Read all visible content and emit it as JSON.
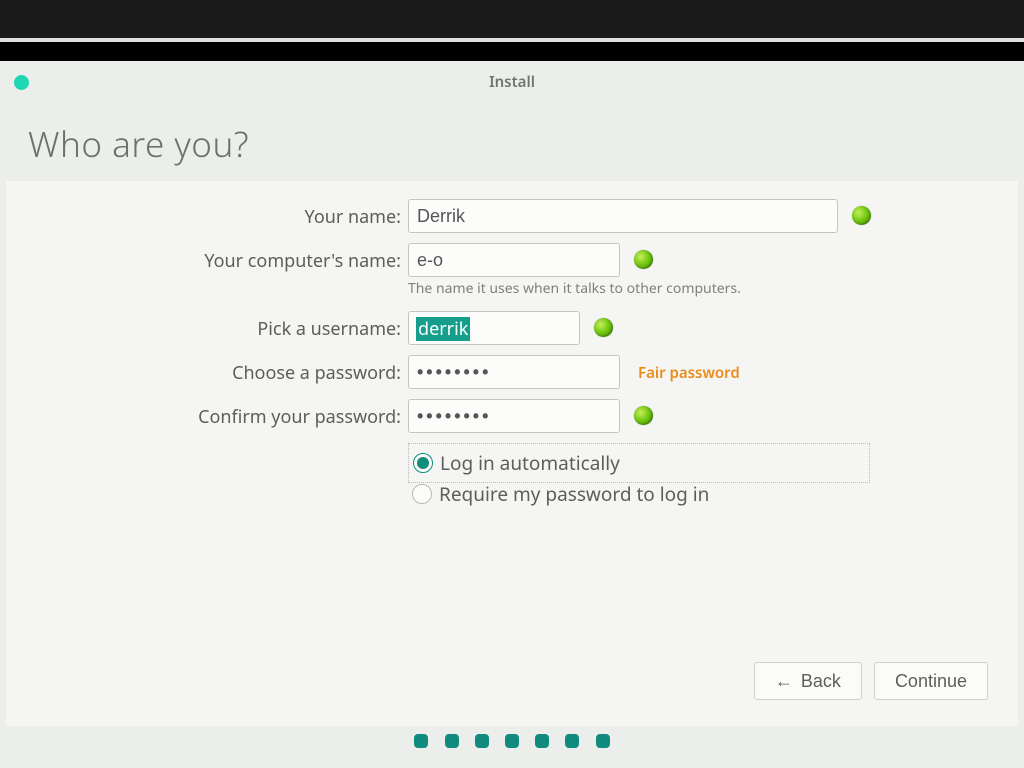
{
  "window": {
    "title": "Install"
  },
  "headline": "Who are you?",
  "labels": {
    "name": "Your name:",
    "computer": "Your computer's name:",
    "username": "Pick a username:",
    "password": "Choose a password:",
    "confirm": "Confirm your password:"
  },
  "values": {
    "name": "Derrik",
    "computer": "e-o",
    "username": "derrik",
    "password": "••••••••",
    "confirm": "••••••••"
  },
  "hints": {
    "computer": "The name it uses when it talks to other computers."
  },
  "password_strength": "Fair password",
  "login_options": {
    "auto": "Log in automatically",
    "require": "Require my password to log in",
    "selected": "auto"
  },
  "buttons": {
    "back": "Back",
    "continue": "Continue"
  },
  "pager_count": 7
}
